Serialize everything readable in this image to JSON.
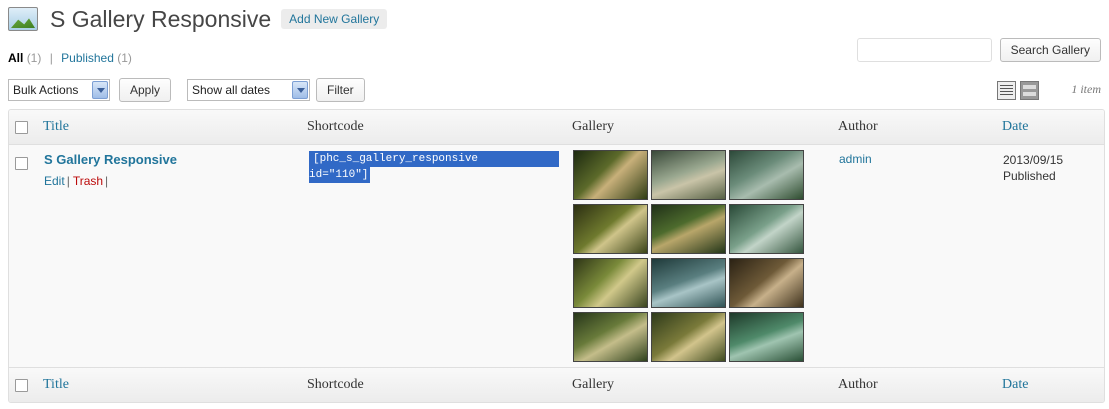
{
  "header": {
    "title": "S Gallery Responsive",
    "add_new": "Add New Gallery",
    "icon": "gallery-image-icon"
  },
  "filters": {
    "all_label": "All",
    "all_count": "(1)",
    "separator": "|",
    "published_label": "Published",
    "published_count": "(1)"
  },
  "search": {
    "value": "",
    "placeholder": "",
    "button": "Search Gallery"
  },
  "tablenav": {
    "bulk_actions": "Bulk Actions",
    "apply": "Apply",
    "dates": "Show all dates",
    "filter": "Filter",
    "items": "1 item",
    "view_icons": [
      "list-view-icon",
      "excerpt-view-icon"
    ]
  },
  "columns": {
    "title": "Title",
    "shortcode": "Shortcode",
    "gallery": "Gallery",
    "author": "Author",
    "date": "Date"
  },
  "row": {
    "title": "S Gallery Responsive",
    "edit": "Edit",
    "trash": "Trash",
    "pipe": "|",
    "shortcode_line1": "[phc_s_gallery_responsive",
    "shortcode_line2": "id=\"110\"]",
    "author": "admin",
    "date": "2013/09/15",
    "status": "Published",
    "thumbnails": [
      "linear-gradient(135deg,#1d2a10 0%,#5c6a2a 40%,#c8b07a 55%,#2f3d14 100%)",
      "linear-gradient(160deg,#3a4a3a 0%,#9aa890 45%,#c9c4a8 60%,#556044 100%)",
      "linear-gradient(150deg,#2d4a3a 0%,#6b8c7a 40%,#a8bcae 60%,#2f4d30 100%)",
      "linear-gradient(140deg,#2c2f12 0%,#6f7a2e 45%,#cfc48a 58%,#3b4418 100%)",
      "linear-gradient(155deg,#203018 0%,#4d6b2d 40%,#b8a66a 55%,#233618 100%)",
      "linear-gradient(145deg,#2a4a38 0%,#7aa08a 45%,#c2d4c8 58%,#35563f 100%)",
      "linear-gradient(135deg,#2e3516 0%,#7a8a3a 40%,#d0c88a 58%,#3a4520 100%)",
      "linear-gradient(160deg,#1f3a3a 0%,#5a7f80 45%,#a8c4c6 60%,#2f5254 100%)",
      "linear-gradient(140deg,#2b2214 0%,#6e5a38 45%,#c7b08a 60%,#3f321d 100%)",
      "linear-gradient(150deg,#27361a 0%,#687a3a 40%,#c4bd8a 58%,#2f421c 100%)",
      "linear-gradient(145deg,#2e3a1a 0%,#7a7a3a 45%,#d2c48c 60%,#3e4a1e 100%)",
      "linear-gradient(160deg,#1e3a2a 0%,#4f8a6a 45%,#9fc4b0 60%,#2a5036 100%)"
    ]
  },
  "colors": {
    "link": "#21759b",
    "trash": "#bc0b0b",
    "selection": "#3169c6"
  }
}
